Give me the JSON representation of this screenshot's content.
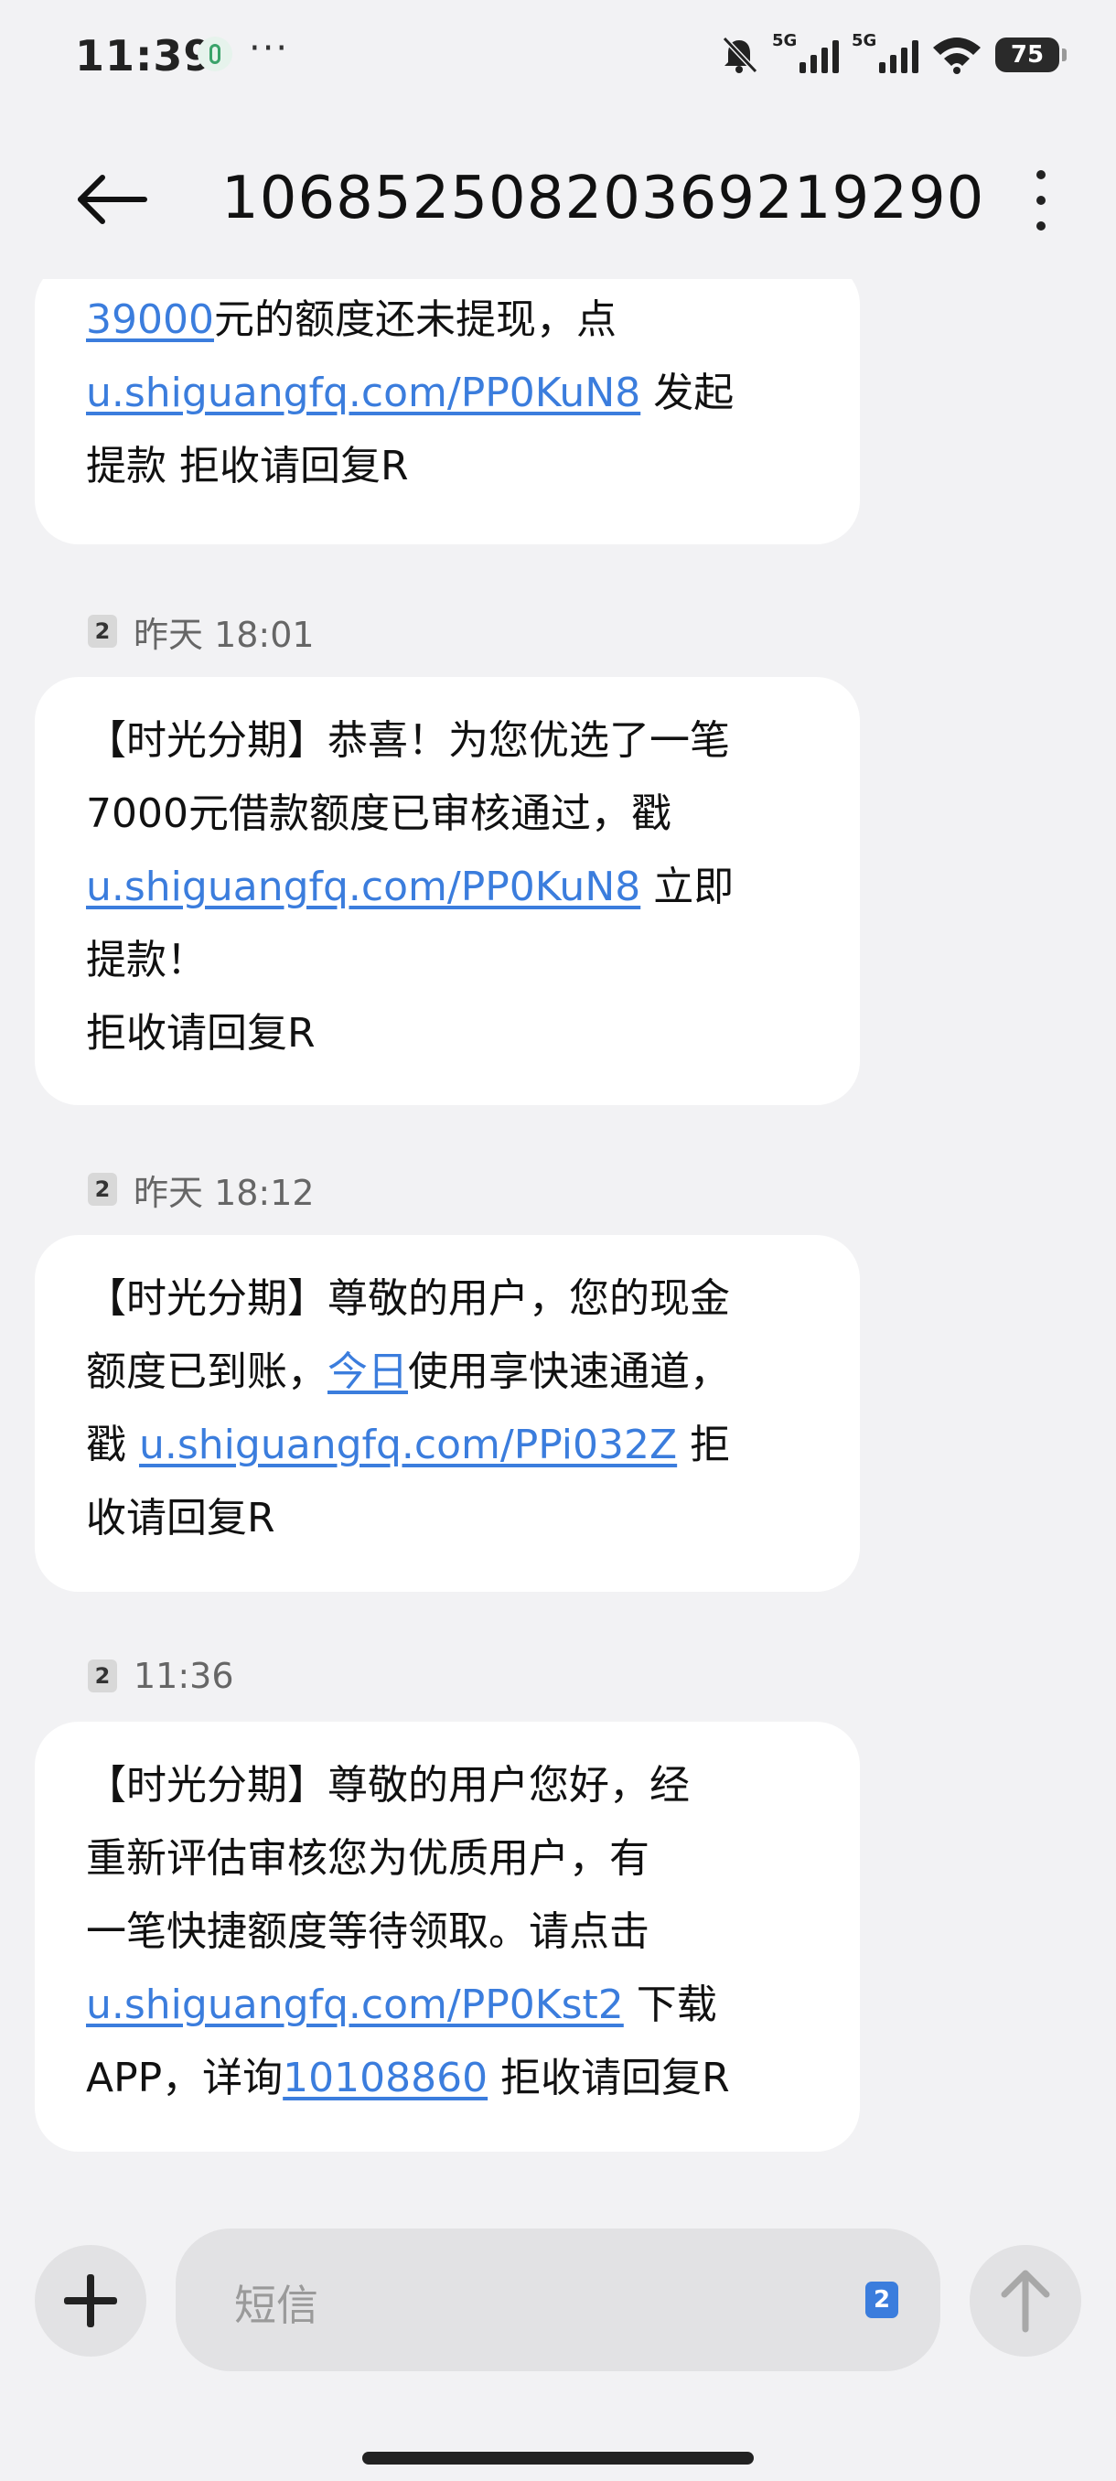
{
  "status_bar": {
    "time": "11:39",
    "more": "···",
    "network_1": "5G",
    "network_2": "5G",
    "battery": "75"
  },
  "header": {
    "title": "106852508203692192​90"
  },
  "messages": [
    {
      "lines": [
        [
          {
            "t": "39000",
            "link": true
          },
          {
            "t": "元的额度还未提现，点"
          }
        ],
        [
          {
            "t": "u.shiguangfq.com/PP0KuN8",
            "link": true
          },
          {
            "t": " 发起"
          }
        ],
        [
          {
            "t": "提款 拒收请回复R"
          }
        ]
      ]
    },
    {
      "sim": "2",
      "time": "昨天 18:01",
      "lines": [
        [
          {
            "t": "【时光分期】恭喜！为您优选了一笔"
          }
        ],
        [
          {
            "t": "7000元借款额度已审核通过，戳"
          }
        ],
        [
          {
            "t": "u.shiguangfq.com/PP0KuN8",
            "link": true
          },
          {
            "t": " 立即"
          }
        ],
        [
          {
            "t": "提款！"
          }
        ],
        [
          {
            "t": " 拒收请回复R"
          }
        ]
      ]
    },
    {
      "sim": "2",
      "time": "昨天 18:12",
      "lines": [
        [
          {
            "t": "【时光分期】尊敬的用户，您的现金"
          }
        ],
        [
          {
            "t": "额度已到账，"
          },
          {
            "t": "今日",
            "link": true
          },
          {
            "t": "使用享快速通道，"
          }
        ],
        [
          {
            "t": "戳 "
          },
          {
            "t": "u.shiguangfq.com/PPi032Z",
            "link": true
          },
          {
            "t": " 拒"
          }
        ],
        [
          {
            "t": "收请回复R"
          }
        ]
      ]
    },
    {
      "sim": "2",
      "time": "11:36",
      "lines": [
        [
          {
            "t": "【时光分期】尊敬的用户您好，经"
          }
        ],
        [
          {
            "t": "重新评估审核您为优质用户，有"
          }
        ],
        [
          {
            "t": "一笔快捷额度等待领取。请点击"
          }
        ],
        [
          {
            "t": "u.shiguangfq.com/PP0Kst2",
            "link": true
          },
          {
            "t": " 下载"
          }
        ],
        [
          {
            "t": "APP，详询"
          },
          {
            "t": "10108860",
            "link": true
          },
          {
            "t": " 拒收请回复R"
          }
        ]
      ]
    }
  ],
  "composer": {
    "placeholder": "短信",
    "sim": "2"
  },
  "icons": {
    "back": "arrow-left-icon",
    "menu": "more-vertical-icon",
    "add": "plus-icon",
    "send": "arrow-up-icon"
  }
}
